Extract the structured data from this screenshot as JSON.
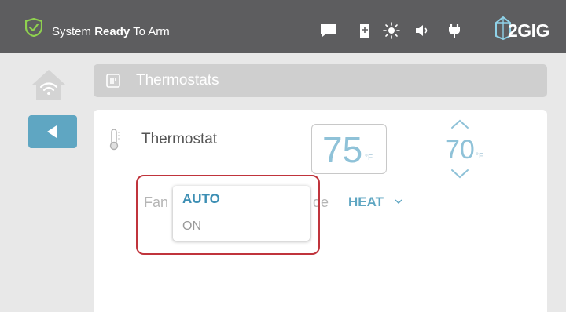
{
  "status_bar": {
    "status_prefix": "System",
    "status_bold": "Ready",
    "status_suffix": "To Arm",
    "brand": "2GIG",
    "icons": [
      "shield-check-icon",
      "message-icon",
      "bookmark-icon",
      "brightness-icon",
      "volume-icon",
      "plug-icon",
      "brand-logo-icon"
    ]
  },
  "nav": {
    "home_icon": "home-wifi-icon",
    "back_icon": "back-arrow-icon"
  },
  "header": {
    "icon": "thermostat-icon",
    "title": "Thermostats"
  },
  "thermostat": {
    "name": "Thermostat",
    "current_temp": "75",
    "current_unit": "°F",
    "setpoint": "70",
    "setpoint_unit": "°F",
    "fan_label": "Fan",
    "mode_label": "de",
    "mode_value": "HEAT"
  },
  "fan_dropdown": {
    "options": [
      "AUTO",
      "ON"
    ],
    "selected": "AUTO"
  },
  "colors": {
    "topbar": "#5d5d5f",
    "accent": "#5fa6c2",
    "highlight": "#c0343c",
    "shield": "#8fd14f"
  }
}
